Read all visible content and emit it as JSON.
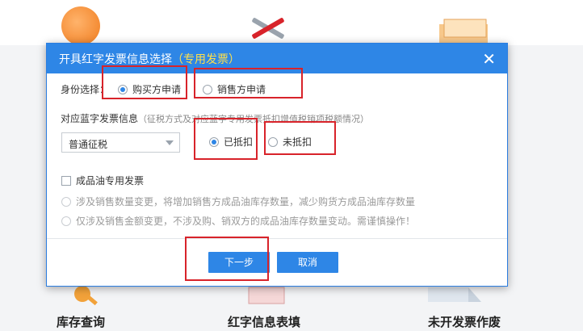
{
  "background": {
    "labels": [
      "库存查询",
      "红字信息表填",
      "未开发票作废"
    ]
  },
  "dialog": {
    "title": "开具红字发票信息选择",
    "title_sub": "（专用发票）",
    "identity_label": "身份选择：",
    "identity_options": [
      "购买方申请",
      "销售方申请"
    ],
    "identity_selected": 0,
    "blue_invoice_label": "对应蓝字发票信息",
    "blue_invoice_hint": "（征税方式及对应蓝字专用发票抵扣增值税销项税额情况）",
    "tax_method": "普通征税",
    "deduct_options": [
      "已抵扣",
      "未抵扣"
    ],
    "deduct_selected": 0,
    "oil_checkbox_label": "成品油专用发票",
    "oil_options": [
      "涉及销售数量变更，将增加销售方成品油库存数量，减少购货方成品油库存数量",
      "仅涉及销售金额变更，不涉及购、销双方的成品油库存数量变动。需谨慎操作！"
    ],
    "next_label": "下一步",
    "cancel_label": "取消"
  },
  "colors": {
    "title_bar": "#2e86e6",
    "title_sub": "#ffe04b",
    "highlight": "#d8232a"
  }
}
